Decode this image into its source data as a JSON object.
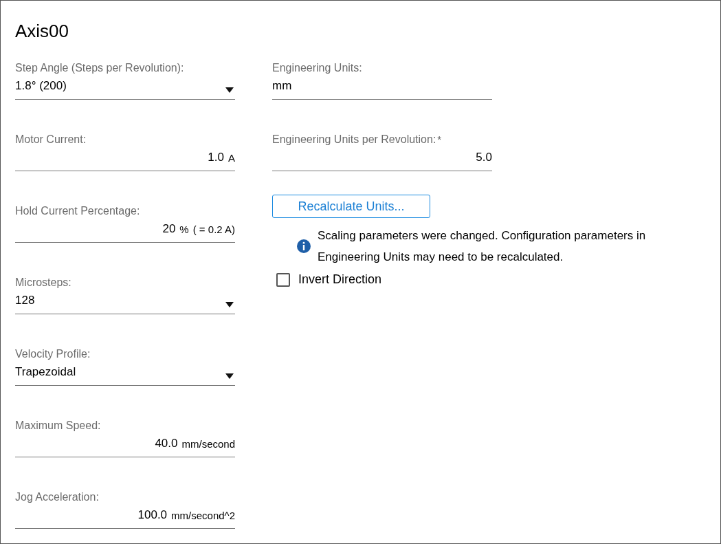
{
  "title": "Axis00",
  "left_fields": [
    {
      "kind": "select",
      "label": "Step Angle (Steps per Revolution):",
      "value": "1.8° (200)"
    },
    {
      "kind": "number",
      "label": "Motor Current:",
      "value": "1.0",
      "unit": "A"
    },
    {
      "kind": "number",
      "label": "Hold Current Percentage:",
      "value": "20",
      "unit": "%",
      "note": "( = 0.2 A)"
    },
    {
      "kind": "select",
      "label": "Microsteps:",
      "value": "128"
    },
    {
      "kind": "select",
      "label": "Velocity Profile:",
      "value": "Trapezoidal"
    },
    {
      "kind": "number",
      "label": "Maximum Speed:",
      "value": "40.0",
      "unit": "mm/second"
    },
    {
      "kind": "number",
      "label": "Jog Acceleration:",
      "value": "100.0",
      "unit": "mm/second^2"
    }
  ],
  "right_fields": [
    {
      "kind": "text",
      "label": "Engineering Units:",
      "value": "mm"
    },
    {
      "kind": "number",
      "label": "Engineering Units per Revolution:",
      "required_mark": "*",
      "value": "5.0"
    }
  ],
  "recalculate_button": "Recalculate Units...",
  "info_message": "Scaling parameters were changed. Configuration parameters in Engineering Units may need to be recalculated.",
  "invert_direction": {
    "label": "Invert Direction",
    "checked": false
  }
}
